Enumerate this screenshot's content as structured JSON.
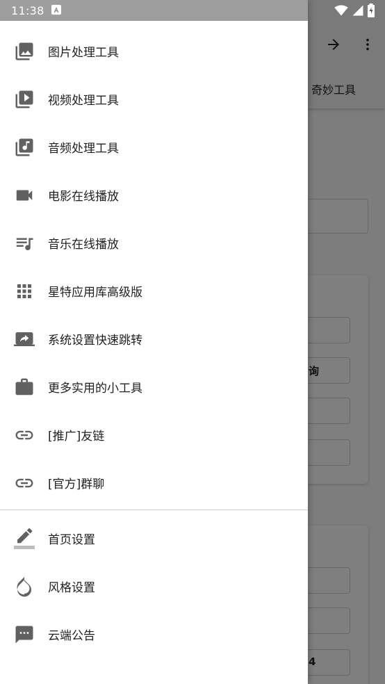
{
  "status_bar": {
    "time": "11:38",
    "notification_icon": "app-notification-icon",
    "wifi_icon": "wifi-icon",
    "signal_icon": "signal-icon",
    "battery_icon": "battery-icon"
  },
  "background_app": {
    "toolbar_forward_icon": "arrow-forward-icon",
    "toolbar_more_icon": "more-vert-icon",
    "tab_label": "奇妙工具",
    "card1_button_fragment": "询",
    "card2_button_fragment": "4"
  },
  "drawer": {
    "main_items": [
      {
        "label": "图片处理工具",
        "icon": "photo-library-icon"
      },
      {
        "label": "视频处理工具",
        "icon": "video-library-icon"
      },
      {
        "label": "音频处理工具",
        "icon": "library-music-icon"
      },
      {
        "label": "电影在线播放",
        "icon": "videocam-icon"
      },
      {
        "label": "音乐在线播放",
        "icon": "queue-music-icon"
      },
      {
        "label": "星特应用库高级版",
        "icon": "apps-grid-icon"
      },
      {
        "label": "系统设置快速跳转",
        "icon": "screen-share-icon"
      },
      {
        "label": "更多实用的小工具",
        "icon": "briefcase-icon"
      },
      {
        "label": "[推广]友链",
        "icon": "link-icon"
      },
      {
        "label": "[官方]群聊",
        "icon": "link-icon"
      }
    ],
    "settings_items": [
      {
        "label": "首页设置",
        "icon": "edit-pencil-icon"
      },
      {
        "label": "风格设置",
        "icon": "opacity-drop-icon"
      },
      {
        "label": "云端公告",
        "icon": "chat-message-icon"
      }
    ]
  },
  "colors": {
    "icon_gray": "#616161",
    "text": "#212121",
    "scrim": "rgba(0,0,0,0.5)",
    "drawer_status": "#9e9e9e"
  }
}
